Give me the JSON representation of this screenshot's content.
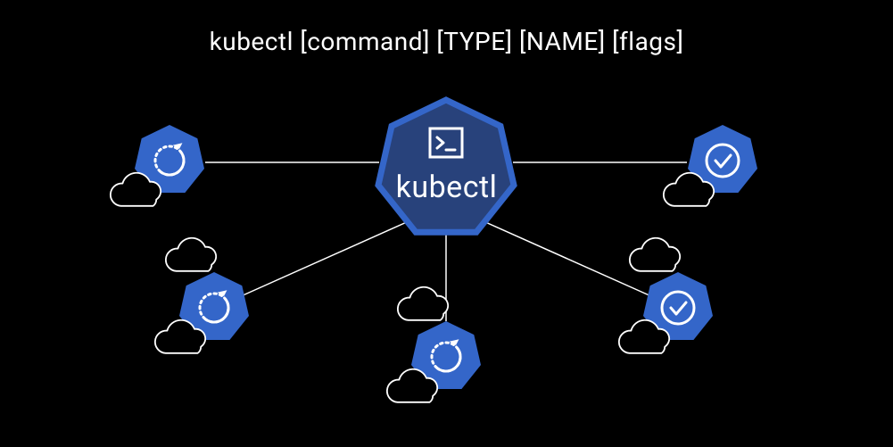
{
  "title": "kubectl [command] [TYPE] [NAME] [flags]",
  "center": {
    "label": "kubectl"
  },
  "colors": {
    "blue": "#3466c9",
    "blue_dark": "#28427b",
    "stroke": "#ffffff",
    "bg": "#000000"
  },
  "nodes": [
    {
      "id": "top-left",
      "type": "refresh"
    },
    {
      "id": "top-right",
      "type": "check"
    },
    {
      "id": "bottom-left",
      "type": "refresh"
    },
    {
      "id": "bottom-mid",
      "type": "refresh"
    },
    {
      "id": "bottom-right",
      "type": "check"
    }
  ]
}
